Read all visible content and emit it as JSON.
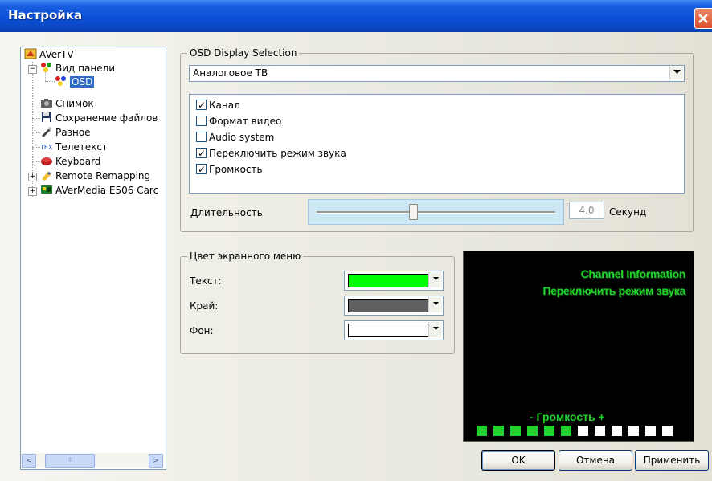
{
  "window": {
    "title": "Настройка",
    "close_icon": "close-icon"
  },
  "tree": {
    "items": [
      {
        "label": "AVerTV",
        "icon": "avertv-icon"
      },
      {
        "label": "Вид панели",
        "icon": "panel-view-icon"
      },
      {
        "label": "OSD",
        "icon": "osd-icon",
        "selected": true
      },
      {
        "label": "Снимок",
        "icon": "camera-icon"
      },
      {
        "label": "Сохранение файлов",
        "icon": "floppy-disk-icon"
      },
      {
        "label": "Разное",
        "icon": "misc-icon"
      },
      {
        "label": "Телетекст",
        "icon": "teletext-icon"
      },
      {
        "label": "Keyboard",
        "icon": "keyboard-icon"
      },
      {
        "label": "Remote Remapping",
        "icon": "remote-icon"
      },
      {
        "label": "AVerMedia E506 Carc",
        "icon": "card-icon"
      }
    ],
    "scroll_left": "<",
    "scroll_right": ">",
    "scroll_grip": "III"
  },
  "osd_display": {
    "group_title": "OSD Display Selection",
    "source_selected": "Аналоговое ТВ",
    "options": [
      {
        "label": "Канал",
        "checked": true
      },
      {
        "label": "Формат видео",
        "checked": false
      },
      {
        "label": "Audio system",
        "checked": false
      },
      {
        "label": "Переключить режим звука",
        "checked": true
      },
      {
        "label": "Громкость",
        "checked": true
      }
    ],
    "duration_label": "Длительность",
    "duration_value": "4.0",
    "duration_unit": "Секунд",
    "duration_fraction": 0.4
  },
  "colors": {
    "group_title": "Цвет экранного меню",
    "text_label": "Текст:",
    "text_color": "#00ff00",
    "edge_label": "Край:",
    "edge_color": "#606060",
    "bg_label": "Фон:",
    "bg_color": "#ffffff"
  },
  "preview": {
    "line1": "Channel Information",
    "line2": "Переключить режим звука",
    "volume_label": "- Громкость +",
    "volume_level": 6,
    "volume_total": 12,
    "active_color": "#22d12b",
    "inactive_color": "#ffffff"
  },
  "buttons": {
    "ok": "OK",
    "cancel": "Отмена",
    "apply": "Применить"
  }
}
